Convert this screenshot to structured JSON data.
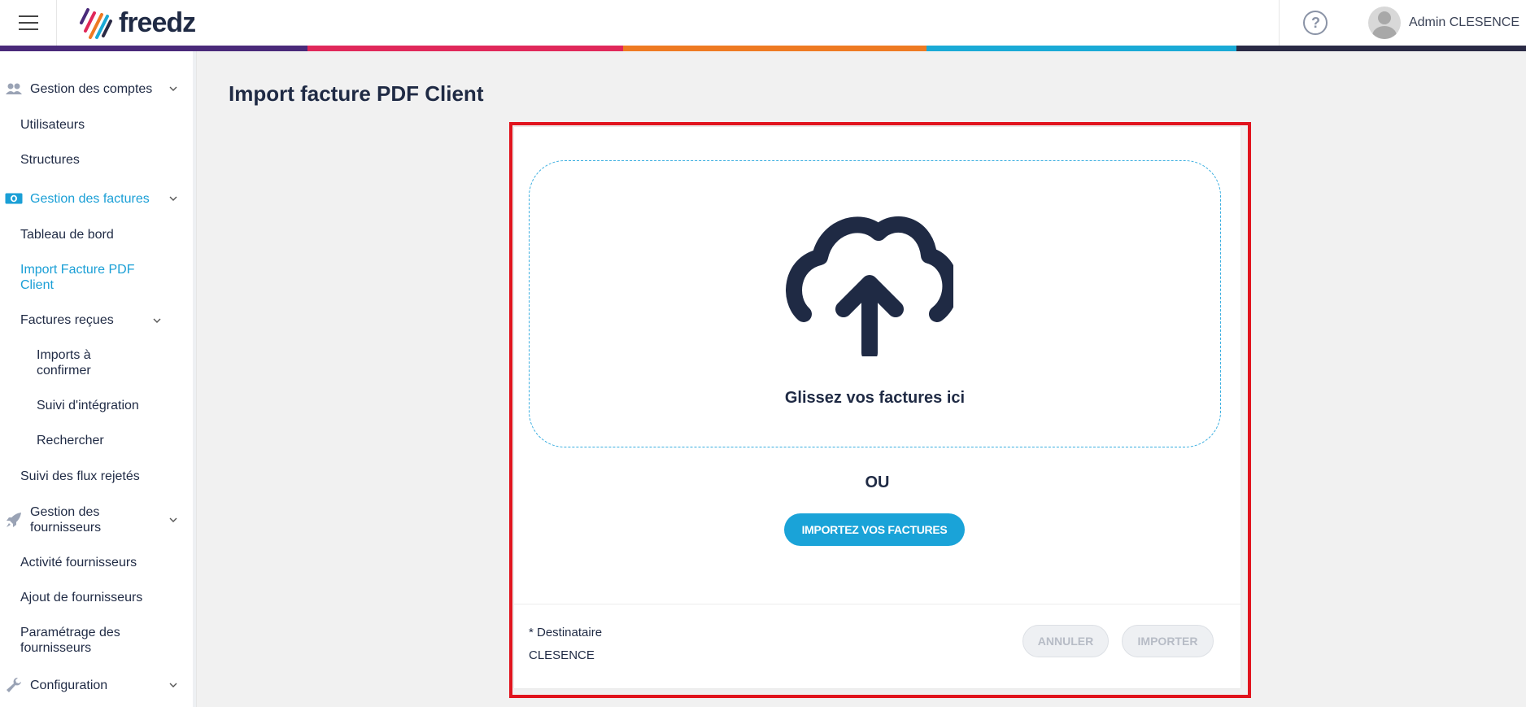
{
  "header": {
    "logo_text": "freedz",
    "help_symbol": "?",
    "user_name": "Admin CLESENCE"
  },
  "colors": {
    "accent": "#1a9fd6",
    "band": [
      "#4a2a7a",
      "#e0285a",
      "#ee7a22",
      "#1aaad6",
      "#2a2a45"
    ],
    "highlight": "#e1141e"
  },
  "sidebar": {
    "sections": [
      {
        "label": "Gestion des comptes",
        "icon": "users-icon"
      },
      {
        "label": "Gestion des factures",
        "icon": "banknote-icon"
      },
      {
        "label": "Gestion des fournisseurs",
        "icon": "rocket-icon"
      },
      {
        "label": "Configuration",
        "icon": "wrench-icon"
      }
    ],
    "items": {
      "utilisateurs": "Utilisateurs",
      "structures": "Structures",
      "tableau_de_bord": "Tableau de bord",
      "import_facture": "Import Facture PDF Client",
      "factures_recues": "Factures reçues",
      "imports_a_confirmer": "Imports à confirmer",
      "suivi_integration": "Suivi d'intégration",
      "rechercher": "Rechercher",
      "suivi_flux_rejetes": "Suivi des flux rejetés",
      "activite_fournisseurs": "Activité fournisseurs",
      "ajout_fournisseurs": "Ajout de fournisseurs",
      "parametrage_fournisseurs": "Paramétrage des fournisseurs"
    }
  },
  "main": {
    "title": "Import facture PDF Client",
    "dropzone_text": "Glissez vos factures ici",
    "or_text": "OU",
    "import_button": "IMPORTEZ VOS FACTURES",
    "recipient_label": "* Destinataire",
    "recipient_value": "CLESENCE",
    "cancel_button": "ANNULER",
    "submit_button": "IMPORTER"
  }
}
